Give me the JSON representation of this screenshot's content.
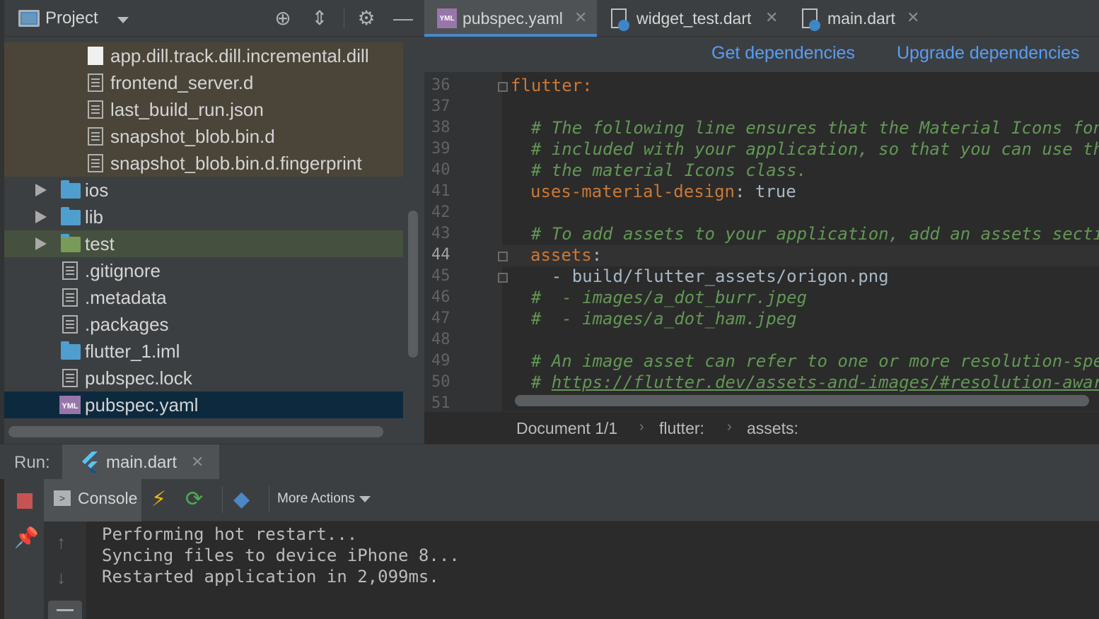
{
  "project_panel": {
    "title": "Project",
    "files": [
      {
        "name": "app.dill.track.dill.incremental.dill",
        "type": "file-white",
        "excluded": true
      },
      {
        "name": "frontend_server.d",
        "type": "file-text",
        "excluded": true
      },
      {
        "name": "last_build_run.json",
        "type": "file-json",
        "excluded": true
      },
      {
        "name": "snapshot_blob.bin.d",
        "type": "file-text",
        "excluded": true
      },
      {
        "name": "snapshot_blob.bin.d.fingerprint",
        "type": "file-text",
        "excluded": true
      },
      {
        "name": "ios",
        "type": "folder"
      },
      {
        "name": "lib",
        "type": "folder"
      },
      {
        "name": "test",
        "type": "folder-test"
      },
      {
        "name": ".gitignore",
        "type": "file-text"
      },
      {
        "name": ".metadata",
        "type": "file-text"
      },
      {
        "name": ".packages",
        "type": "file-text"
      },
      {
        "name": "flutter_1.iml",
        "type": "module"
      },
      {
        "name": "pubspec.lock",
        "type": "file-text"
      },
      {
        "name": "pubspec.yaml",
        "type": "yaml",
        "selected": true
      }
    ]
  },
  "editor": {
    "tabs": [
      {
        "label": "pubspec.yaml",
        "icon": "yaml-icon",
        "active": true
      },
      {
        "label": "widget_test.dart",
        "icon": "dart-file-icon",
        "active": false
      },
      {
        "label": "main.dart",
        "icon": "dart-file-icon",
        "active": false
      }
    ],
    "notice_actions": {
      "get": "Get dependencies",
      "upgrade": "Upgrade dependencies"
    },
    "lines": [
      {
        "n": "36",
        "text": "flutter:"
      },
      {
        "n": "37",
        "text": ""
      },
      {
        "n": "38",
        "text": "  # The following line ensures that the Material Icons font"
      },
      {
        "n": "39",
        "text": "  # included with your application, so that you can use the"
      },
      {
        "n": "40",
        "text": "  # the material Icons class."
      },
      {
        "n": "41",
        "key": "uses-material-design",
        "value": " true"
      },
      {
        "n": "42",
        "text": ""
      },
      {
        "n": "43",
        "text": "  # To add assets to your application, add an assets section"
      },
      {
        "n": "44",
        "key": "assets",
        "value": ""
      },
      {
        "n": "45",
        "text": "    - build/flutter_assets/origon.png"
      },
      {
        "n": "46",
        "text": "  #  - images/a_dot_burr.jpeg"
      },
      {
        "n": "47",
        "text": "  #  - images/a_dot_ham.jpeg"
      },
      {
        "n": "48",
        "text": ""
      },
      {
        "n": "49",
        "text": "  # An image asset can refer to one or more resolution-speci"
      },
      {
        "n": "50",
        "text": "  # ",
        "url": "https://flutter.dev/assets-and-images/#resolution-aware."
      },
      {
        "n": "51",
        "text": ""
      }
    ],
    "breadcrumb": [
      "Document 1/1",
      "flutter:",
      "assets:"
    ]
  },
  "run_panel": {
    "label": "Run:",
    "tab_label": "main.dart",
    "console_label": "Console",
    "more_actions": "More Actions",
    "output": [
      "Performing hot restart...",
      "Syncing files to device iPhone 8...",
      "Restarted application in 2,099ms."
    ]
  },
  "colors": {
    "keyword": "#cc7832",
    "comment": "#629755",
    "link": "#589df6",
    "selection": "#0d293e"
  }
}
